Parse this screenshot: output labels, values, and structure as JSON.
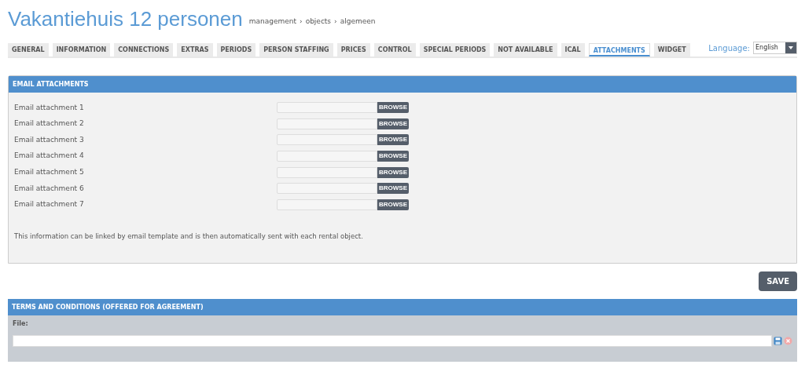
{
  "page": {
    "title": "Vakantiehuis 12 personen",
    "breadcrumb": [
      "management",
      "objects",
      "algemeen"
    ],
    "breadcrumb_separator": "›"
  },
  "tabs": [
    {
      "label": "GENERAL",
      "selected": false
    },
    {
      "label": "INFORMATION",
      "selected": false
    },
    {
      "label": "CONNECTIONS",
      "selected": false
    },
    {
      "label": "EXTRAS",
      "selected": false
    },
    {
      "label": "PERIODS",
      "selected": false
    },
    {
      "label": "PERSON STAFFING",
      "selected": false
    },
    {
      "label": "PRICES",
      "selected": false
    },
    {
      "label": "CONTROL",
      "selected": false
    },
    {
      "label": "SPECIAL PERIODS",
      "selected": false
    },
    {
      "label": "NOT AVAILABLE",
      "selected": false
    },
    {
      "label": "ICAL",
      "selected": false
    },
    {
      "label": "ATTACHMENTS",
      "selected": true
    },
    {
      "label": "WIDGET",
      "selected": false
    }
  ],
  "language": {
    "label": "Language:",
    "value": "English"
  },
  "email_attachments": {
    "title": "EMAIL ATTACHMENTS",
    "rows": [
      {
        "label": "Email attachment 1",
        "button": "BROWSE"
      },
      {
        "label": "Email attachment 2",
        "button": "BROWSE"
      },
      {
        "label": "Email attachment 3",
        "button": "BROWSE"
      },
      {
        "label": "Email attachment 4",
        "button": "BROWSE"
      },
      {
        "label": "Email attachment 5",
        "button": "BROWSE"
      },
      {
        "label": "Email attachment 6",
        "button": "BROWSE"
      },
      {
        "label": "Email attachment 7",
        "button": "BROWSE"
      }
    ],
    "note": "This information can be linked by email template and is then automatically sent with each rental object."
  },
  "save_button": "SAVE",
  "terms": {
    "title": "TERMS AND CONDITIONS (OFFERED FOR AGREEMENT)",
    "file_label": "File:"
  }
}
